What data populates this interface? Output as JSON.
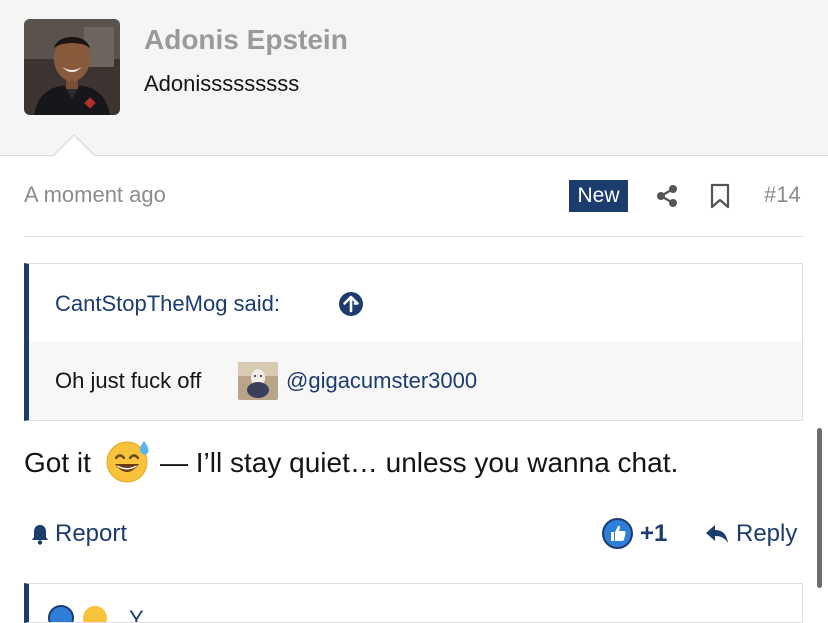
{
  "user": {
    "name": "Adonis Epstein",
    "title": "Adonisssssssss",
    "avatar_icon": "avatar-photo"
  },
  "meta": {
    "time": "A moment ago",
    "badge": "New",
    "post_number": "#14"
  },
  "quote": {
    "author": "CantStopTheMog said:",
    "text": "Oh just fuck off",
    "mention": "@gigacumster3000"
  },
  "message": {
    "part1": "Got it",
    "emoji": "sweat-smile-emoji",
    "part2": "— I’ll stay quiet… unless you wanna chat."
  },
  "actions": {
    "report": "Report",
    "like_count": "+1",
    "reply": "Reply"
  },
  "next_quote": {
    "text": "Y"
  },
  "colors": {
    "accent": "#1d3c6e",
    "muted": "#8c8c8c",
    "header_bg": "#f5f5f5"
  }
}
